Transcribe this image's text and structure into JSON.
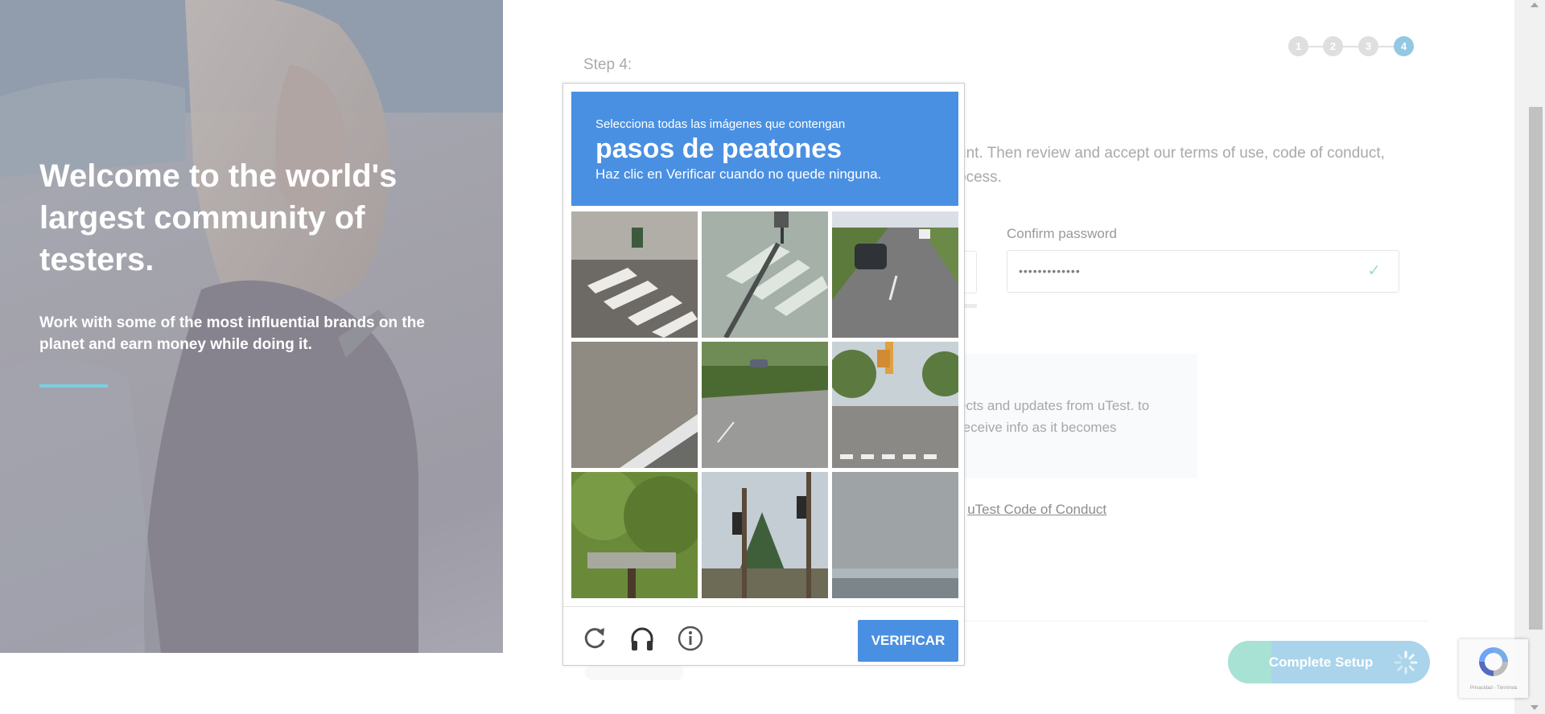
{
  "hero": {
    "title": "Welcome to the world's largest community of testers.",
    "subtitle": "Work with some of the most influential brands on the planet and earn money while doing it."
  },
  "steps": [
    "1",
    "2",
    "3",
    "4"
  ],
  "form": {
    "step_label": "Step 4:",
    "intro": "unt. Then review and accept our terms of use, code of conduct, ocess.",
    "confirm_label": "Confirm password",
    "confirm_value": "•••••••••••••",
    "notice": "ects and updates from uTest. to receive info as it becomes",
    "coc_prefix": "e ",
    "coc_link": "uTest Code of Conduct",
    "complete_button": "Complete Setup"
  },
  "captcha": {
    "instruction": "Selecciona todas las imágenes que contengan",
    "target": "pasos de peatones",
    "hint": "Haz clic en Verificar cuando no quede ninguna.",
    "verify_button": "VERIFICAR",
    "tiles": [
      "crosswalk-street-tile",
      "crosswalk-shadow-tile",
      "highway-car-tile",
      "pavement-tile",
      "curved-road-tile",
      "intersection-crosswalk-tile",
      "tree-tile",
      "traffic-light-tile",
      "sky-tile"
    ]
  },
  "recaptcha_badge": {
    "terms": "Privacidad - Términos"
  },
  "colors": {
    "captcha_blue": "#4a90e2",
    "step_active": "#6fb6d9",
    "hero_rule": "#7ad0e0"
  }
}
